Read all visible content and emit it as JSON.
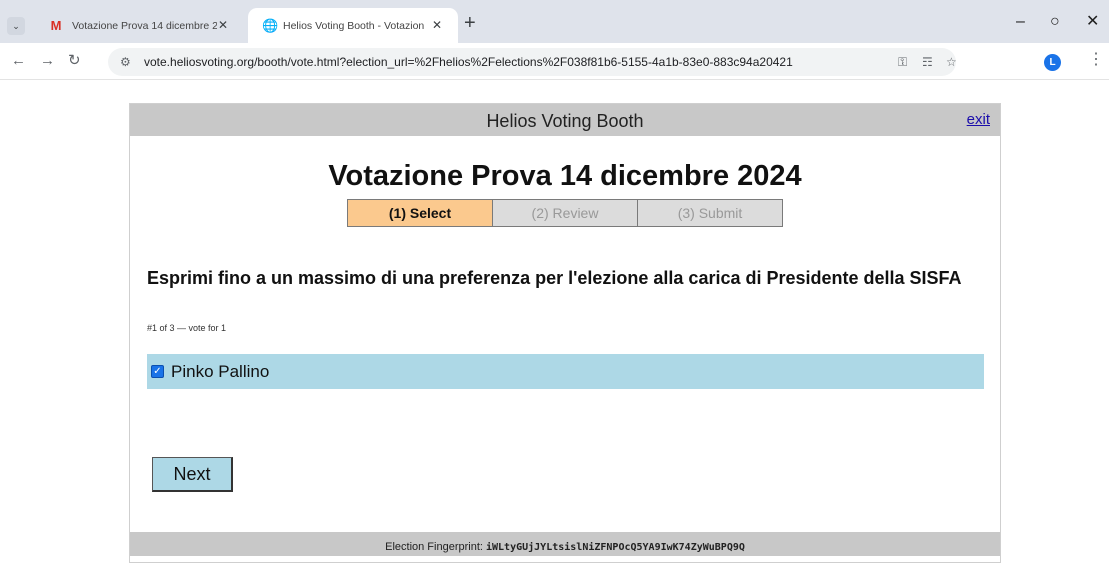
{
  "browser": {
    "tabs": [
      {
        "title": "Votazione Prova 14 dicembre 2",
        "icon": "gmail-icon",
        "active": false
      },
      {
        "title": "Helios Voting Booth - Votazion",
        "icon": "globe-icon",
        "active": true
      }
    ],
    "url": "vote.heliosvoting.org/booth/vote.html?election_url=%2Fhelios%2Felections%2F038f81b6-5155-4a1b-83e0-883c94a20421",
    "profile_initial": "L"
  },
  "booth": {
    "header_title": "Helios Voting Booth",
    "exit_label": "exit",
    "election_title": "Votazione Prova 14 dicembre 2024",
    "steps": [
      {
        "label": "(1) Select",
        "current": true
      },
      {
        "label": "(2) Review",
        "current": false
      },
      {
        "label": "(3) Submit",
        "current": false
      }
    ],
    "question": "Esprimi fino a un massimo di una preferenza per l'elezione alla carica di Presidente della SISFA",
    "question_meta": "#1 of 3 — vote for 1",
    "answers": [
      {
        "label": "Pinko Pallino",
        "checked": true
      }
    ],
    "next_label": "Next",
    "fingerprint_label": "Election Fingerprint:",
    "fingerprint_value": "iWLtyGUjJYLtsislNiZFNPOcQ5YA9IwK74ZyWuBPQ9Q"
  },
  "colors": {
    "header_bg": "#c8c8c8",
    "current_step": "#fbc98e",
    "answer_bg": "#add8e6",
    "link": "#1a0dab"
  }
}
